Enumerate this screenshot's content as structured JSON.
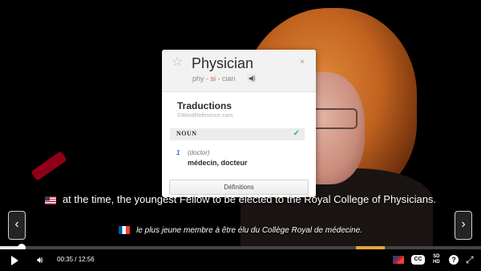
{
  "popup": {
    "word": "Physician",
    "pron_pre": "phy - ",
    "pron_stress": "si",
    "pron_post": " - cian",
    "close": "×",
    "heading": "Traductions",
    "source": "©WordReference.com",
    "pos": "NOUN",
    "sense_number": "1",
    "sense_context": "(doctor)",
    "sense_translation": "médecin, docteur",
    "definitions_label": "Définitions",
    "icons": {
      "star": "star-icon",
      "speaker": "speaker-icon",
      "check": "check-icon"
    },
    "colors": {
      "stress": "#e4572e",
      "check": "#3aa86b",
      "sense_number": "#3b6dc9"
    }
  },
  "subtitles": {
    "english": "at the time, the youngest Fellow to be elected to the Royal College of Physicians.",
    "french": "le plus jeune membre à être élu du Collège Royal de médecine."
  },
  "nav": {
    "prev": "‹",
    "next": "›"
  },
  "player": {
    "current_time": "00:35",
    "separator": " / ",
    "duration": "12:56",
    "progress_fraction": 0.045,
    "buffered_start_fraction": 0.74,
    "buffered_end_fraction": 0.8,
    "cc_label": "CC",
    "quality_sd": "SD",
    "quality_hd": "HD",
    "help": "?",
    "colors": {
      "buffered": "#e8a33a",
      "progress": "#e9e9e9"
    }
  }
}
